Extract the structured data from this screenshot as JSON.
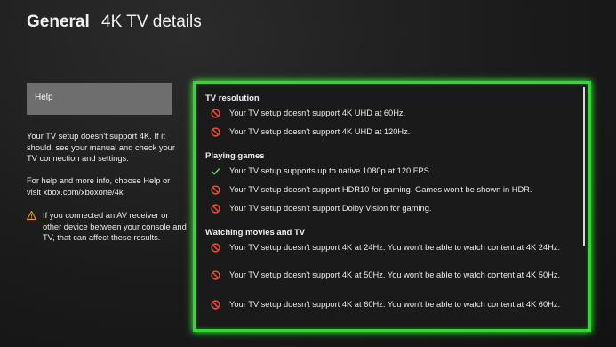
{
  "header": {
    "section": "General",
    "title": "4K TV details"
  },
  "sidebar": {
    "help_label": "Help",
    "info1": "Your TV setup doesn't support 4K. If it should, see your manual and check your TV connection and settings.",
    "info2": "For help and more info, choose Help or visit xbox.com/xboxone/4k",
    "warning": "If you connected an AV receiver or other device between your console and TV, that can affect these results."
  },
  "colors": {
    "focus": "#34d832",
    "error": "#e8503a",
    "ok": "#4fd24a",
    "warning": "#e5a100"
  },
  "details": {
    "groups": [
      {
        "title": "TV resolution",
        "items": [
          {
            "icon": "no-icon",
            "text": "Your TV setup doesn't support 4K UHD at 60Hz."
          },
          {
            "icon": "no-icon",
            "text": "Your TV setup doesn't support 4K UHD at 120Hz."
          }
        ]
      },
      {
        "title": "Playing games",
        "items": [
          {
            "icon": "check-icon",
            "text": "Your TV setup supports up to native 1080p at 120 FPS."
          },
          {
            "icon": "no-icon",
            "text": "Your TV setup doesn't support HDR10 for gaming. Games won't be shown in HDR."
          },
          {
            "icon": "no-icon",
            "text": "Your TV setup doesn't support Dolby Vision for gaming."
          }
        ]
      },
      {
        "title": "Watching movies and TV",
        "items": [
          {
            "icon": "no-icon",
            "text": "Your TV setup doesn't support 4K at 24Hz. You won't be able to watch content at 4K 24Hz."
          },
          {
            "icon": "no-icon",
            "text": "Your TV setup doesn't support 4K at 50Hz. You won't be able to watch content at 4K 50Hz."
          },
          {
            "icon": "no-icon",
            "text": "Your TV setup doesn't support 4K at 60Hz. You won't be able to watch content at 4K 60Hz."
          }
        ]
      }
    ]
  }
}
